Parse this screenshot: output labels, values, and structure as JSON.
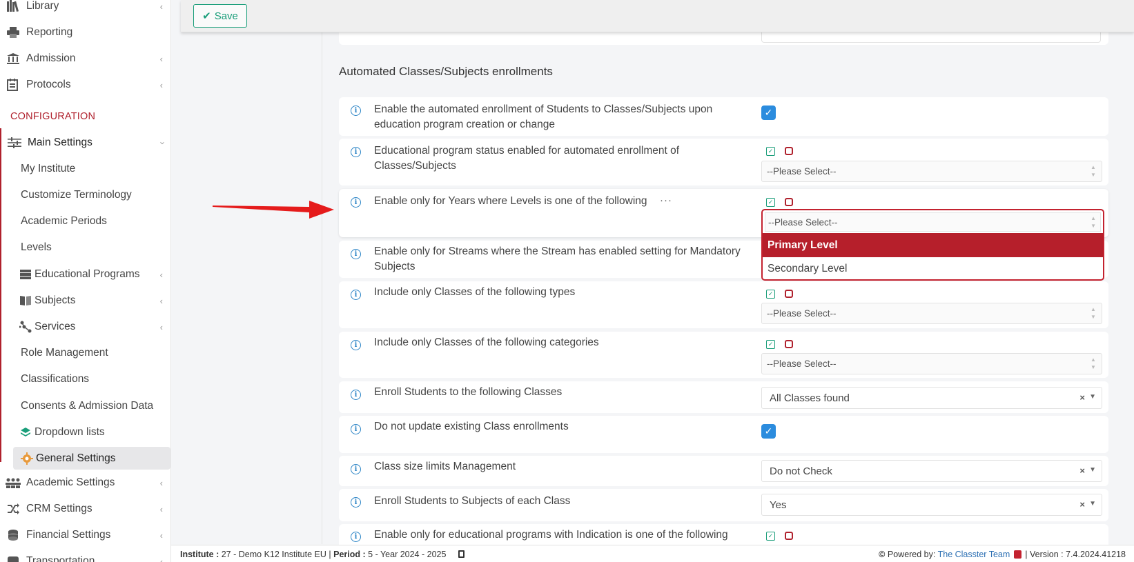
{
  "sidebar": {
    "items": [
      {
        "label": "Library",
        "icon": "books-icon"
      },
      {
        "label": "Reporting",
        "icon": "printer-icon"
      },
      {
        "label": "Admission",
        "icon": "bank-icon"
      },
      {
        "label": "Protocols",
        "icon": "register-icon"
      }
    ],
    "section_label": "CONFIGURATION",
    "main_settings": "Main Settings",
    "sub_items": [
      "My Institute",
      "Customize Terminology",
      "Academic Periods",
      "Levels",
      "Educational Programs",
      "Subjects",
      "Services",
      "Role Management",
      "Classifications",
      "Consents & Admission Data",
      "Dropdown lists",
      "General Settings"
    ],
    "bottom_items": [
      "Academic Settings",
      "CRM Settings",
      "Financial Settings",
      "Transportation"
    ]
  },
  "toolbar": {
    "save_label": "Save"
  },
  "section": {
    "title": "Automated Classes/Subjects enrollments"
  },
  "settings": [
    {
      "label": "Enable the automated enrollment of Students to Classes/Subjects upon education program creation or change",
      "control": "checkbox",
      "checked": true
    },
    {
      "label": "Educational program status enabled for automated enrollment of Classes/Subjects",
      "control": "multiselect",
      "placeholder": "--Please Select--"
    },
    {
      "label": "Enable only for Years where Levels is one of the following",
      "control": "multiselect-open",
      "placeholder": "--Please Select--",
      "more": "···"
    },
    {
      "label": "Enable only for Streams where the Stream has enabled setting for Mandatory Subjects",
      "control": "multiselect"
    },
    {
      "label": "Include only Classes of the following types",
      "control": "multiselect",
      "placeholder": "--Please Select--"
    },
    {
      "label": "Include only Classes of the following categories",
      "control": "multiselect",
      "placeholder": "--Please Select--"
    },
    {
      "label": "Enroll Students to the following Classes",
      "control": "select",
      "value": "All Classes found"
    },
    {
      "label": "Do not update existing Class enrollments",
      "control": "checkbox",
      "checked": true
    },
    {
      "label": "Class size limits Management",
      "control": "select",
      "value": "Do not Check"
    },
    {
      "label": "Enroll Students to Subjects of each Class",
      "control": "select",
      "value": "Yes"
    },
    {
      "label": "Enable only for educational programs with Indication is one of the following",
      "control": "multiselect"
    }
  ],
  "dropdown": {
    "placeholder": "--Please Select--",
    "options": [
      {
        "label": "Primary Level",
        "selected": true
      },
      {
        "label": "Secondary Level",
        "selected": false
      }
    ]
  },
  "footer": {
    "institute_label": "Institute :",
    "institute_value": "27 - Demo K12 Institute EU",
    "period_label": "Period :",
    "period_value": "5 - Year 2024 - 2025",
    "powered_label": "Powered by:",
    "powered_link": "The Classter Team",
    "version_label": "Version :",
    "version_value": "7.4.2024.41218"
  },
  "colors": {
    "accent": "#b0212d",
    "success": "#1a9e7a",
    "checkbox": "#2b8cde",
    "info": "#2b84c6"
  }
}
